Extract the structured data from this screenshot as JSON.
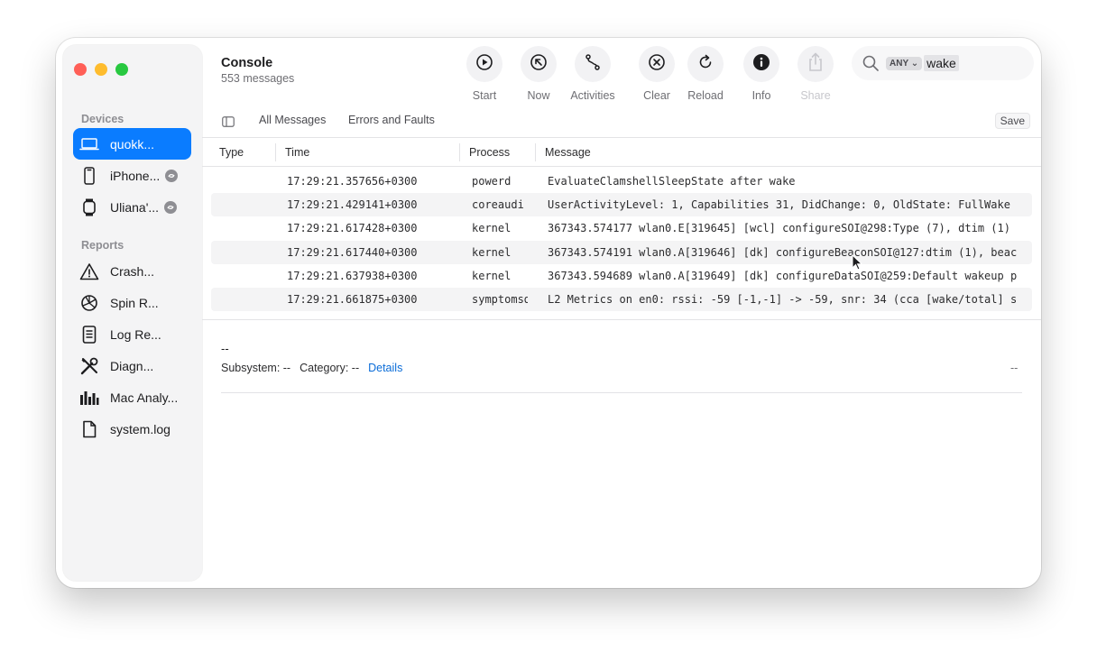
{
  "window": {
    "title": "Console",
    "subtitle": "553 messages",
    "traffic_colors": [
      "#ff5f57",
      "#febc2e",
      "#28c840"
    ]
  },
  "sidebar": {
    "devices_label": "Devices",
    "devices": [
      {
        "label": "quokk...",
        "icon": "laptop-icon",
        "selected": true
      },
      {
        "label": "iPhone...",
        "icon": "iphone-icon"
      },
      {
        "label": "Uliana'...",
        "icon": "watch-icon"
      }
    ],
    "reports_label": "Reports",
    "reports": [
      {
        "label": "Crash...",
        "icon": "warning-icon"
      },
      {
        "label": "Spin R...",
        "icon": "spin-icon"
      },
      {
        "label": "Log Re...",
        "icon": "document-icon"
      },
      {
        "label": "Diagn...",
        "icon": "tools-icon"
      },
      {
        "label": "Mac Analy...",
        "icon": "bar-chart-icon"
      },
      {
        "label": "system.log",
        "icon": "file-icon"
      }
    ]
  },
  "toolbar": {
    "start": "Start",
    "now": "Now",
    "activities": "Activities",
    "clear": "Clear",
    "reload": "Reload",
    "info": "Info",
    "share": "Share"
  },
  "search": {
    "scope": "ANY",
    "scope_chevron": "⌄",
    "token": "wake"
  },
  "filters": {
    "all_messages": "All Messages",
    "errors_and_faults": "Errors and Faults",
    "save": "Save"
  },
  "table": {
    "columns": {
      "type": "Type",
      "time": "Time",
      "process": "Process",
      "message": "Message"
    },
    "rows": [
      {
        "time": "17:29:21.357656+0300",
        "process": "powerd",
        "message": "EvaluateClamshellSleepState after wake"
      },
      {
        "time": "17:29:21.429141+0300",
        "process": "coreaudi",
        "message": "UserActivityLevel: 1, Capabilities 31, DidChange: 0, OldState: FullWake"
      },
      {
        "time": "17:29:21.617428+0300",
        "process": "kernel",
        "message": "367343.574177 wlan0.E[319645] [wcl] configureSOI@298:Type (7), dtim (1)"
      },
      {
        "time": "17:29:21.617440+0300",
        "process": "kernel",
        "message": "367343.574191 wlan0.A[319646] [dk] configureBeaconSOI@127:dtim (1), beac"
      },
      {
        "time": "17:29:21.637938+0300",
        "process": "kernel",
        "message": "367343.594689 wlan0.A[319649] [dk] configureDataSOI@259:Default wakeup p"
      },
      {
        "time": "17:29:21.661875+0300",
        "process": "symptomsd",
        "message": "L2 Metrics on en0: rssi: -59 [-1,-1] -> -59, snr: 34 (cca [wake/total] s"
      }
    ]
  },
  "detail": {
    "dash": "--",
    "subsystem": "Subsystem: --",
    "category": "Category: --",
    "details_link": "Details",
    "right_dash": "--"
  }
}
